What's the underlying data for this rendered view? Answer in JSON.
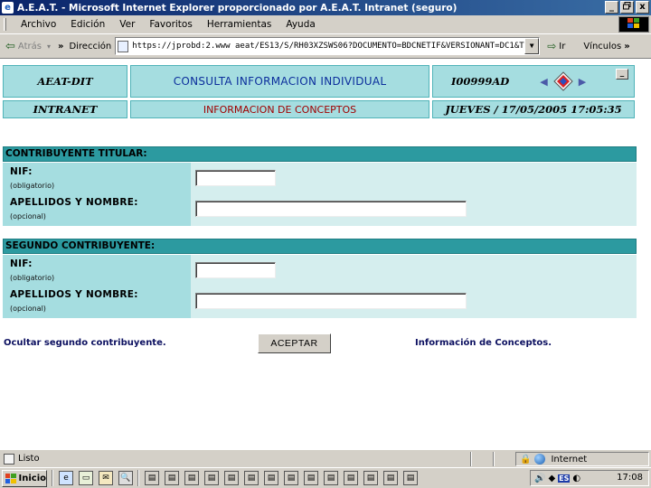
{
  "window": {
    "title": "A.E.A.T. - Microsoft Internet Explorer proporcionado por A.E.A.T. Intranet (seguro)",
    "minimize": "_",
    "maximize": "0",
    "close": "x"
  },
  "menu": {
    "items": [
      "Archivo",
      "Edición",
      "Ver",
      "Favoritos",
      "Herramientas",
      "Ayuda"
    ]
  },
  "toolbar": {
    "back_label": "Atrás",
    "chevron": "»",
    "address_label": "Dirección",
    "address_value": "https://jprobd:2.www aeat/ES13/S/RH03XZSWS06?DOCUMENTO=BDCNETIF&VERSIONANT=DC1&T",
    "go_label": "Ir",
    "links_label": "Vínculos",
    "links_chevron": "»"
  },
  "header": {
    "org": "AEAT-DIT",
    "title": "CONSULTA INFORMACION INDIVIDUAL",
    "user_code": "I00999AD",
    "network": "INTRANET",
    "subtitle": "INFORMACION DE CONCEPTOS",
    "datetime": "JUEVES / 17/05/2005 17:05:35"
  },
  "section1": {
    "heading": "CONTRIBUYENTE TITULAR:",
    "nif_label": "NIF:",
    "nif_hint": "(obligatorio)",
    "nif_value": "",
    "name_label": "APELLIDOS Y NOMBRE:",
    "name_hint": "(opcional)",
    "name_value": ""
  },
  "section2": {
    "heading": "SEGUNDO CONTRIBUYENTE:",
    "nif_label": "NIF:",
    "nif_hint": "(obligatorio)",
    "nif_value": "",
    "name_label": "APELLIDOS Y NOMBRE:",
    "name_hint": "(opcional)",
    "name_value": ""
  },
  "actions": {
    "hide_second": "Ocultar segundo contribuyente.",
    "accept": "ACEPTAR",
    "concepts_info": "Información de Conceptos."
  },
  "status": {
    "text": "Listo",
    "zone": "Internet"
  },
  "taskbar": {
    "start": "Inicio",
    "tray_lang": "ES",
    "clock": "17:08"
  },
  "colors": {
    "title_bar": "#0a246a",
    "cell_bg": "#a5dde0",
    "section_head": "#2c9aa0",
    "section_body": "#d5eeee",
    "title_text": "#0c2e9c",
    "subtitle_text": "#a00000"
  }
}
